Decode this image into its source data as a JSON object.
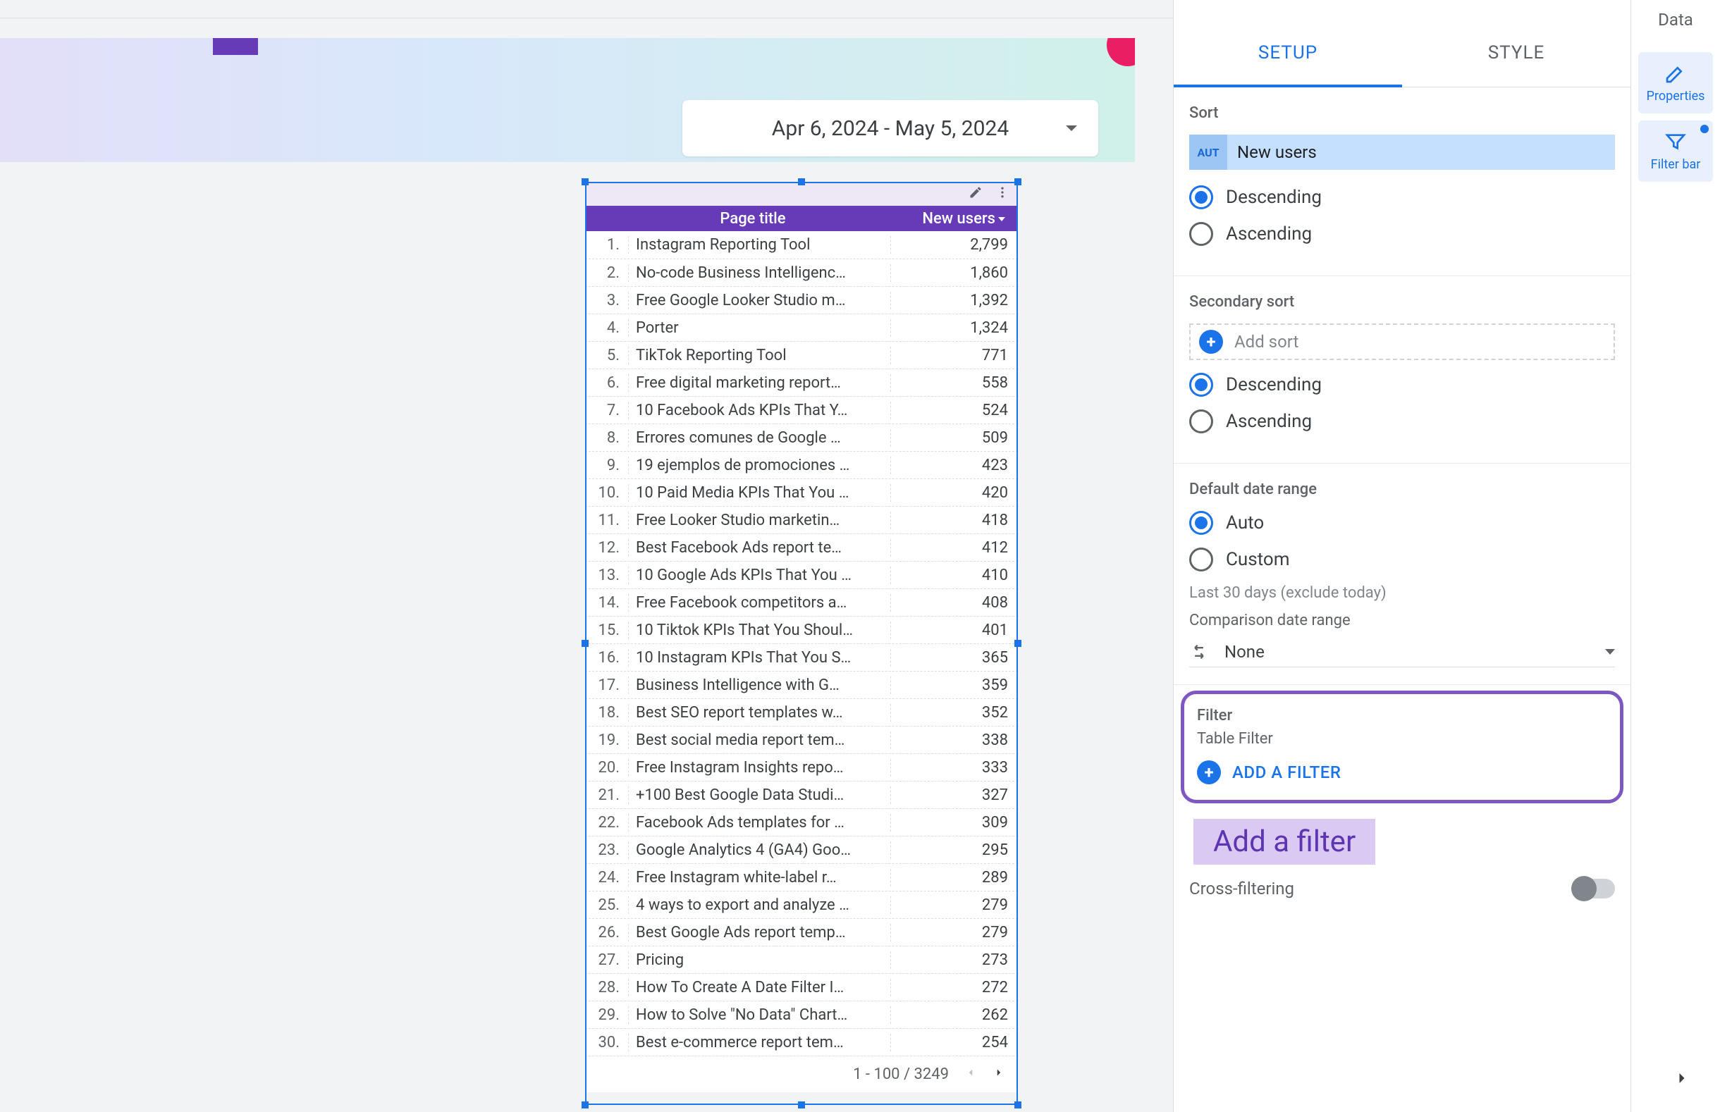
{
  "banner": {
    "date_range": "Apr 6, 2024 - May 5, 2024"
  },
  "chart": {
    "header": {
      "idx": "",
      "title": "Page title",
      "value": "New users"
    },
    "rows": [
      {
        "idx": "1.",
        "title": "Instagram Reporting Tool",
        "value": "2,799"
      },
      {
        "idx": "2.",
        "title": "No-code Business Intelligenc…",
        "value": "1,860"
      },
      {
        "idx": "3.",
        "title": "Free Google Looker Studio m…",
        "value": "1,392"
      },
      {
        "idx": "4.",
        "title": "Porter",
        "value": "1,324"
      },
      {
        "idx": "5.",
        "title": "TikTok Reporting Tool",
        "value": "771"
      },
      {
        "idx": "6.",
        "title": "Free digital marketing report…",
        "value": "558"
      },
      {
        "idx": "7.",
        "title": "10 Facebook Ads KPIs That Y…",
        "value": "524"
      },
      {
        "idx": "8.",
        "title": "Errores comunes de Google …",
        "value": "509"
      },
      {
        "idx": "9.",
        "title": "19 ejemplos de promociones …",
        "value": "423"
      },
      {
        "idx": "10.",
        "title": "10 Paid Media KPIs That You …",
        "value": "420"
      },
      {
        "idx": "11.",
        "title": "Free Looker Studio marketin…",
        "value": "418"
      },
      {
        "idx": "12.",
        "title": "Best Facebook Ads report te…",
        "value": "412"
      },
      {
        "idx": "13.",
        "title": "10 Google Ads KPIs That You …",
        "value": "410"
      },
      {
        "idx": "14.",
        "title": "Free Facebook competitors a…",
        "value": "408"
      },
      {
        "idx": "15.",
        "title": "10 Tiktok KPIs That You Shoul…",
        "value": "401"
      },
      {
        "idx": "16.",
        "title": "10 Instagram KPIs That You S…",
        "value": "365"
      },
      {
        "idx": "17.",
        "title": "Business Intelligence with G…",
        "value": "359"
      },
      {
        "idx": "18.",
        "title": "Best SEO report templates w…",
        "value": "352"
      },
      {
        "idx": "19.",
        "title": "Best social media report tem…",
        "value": "338"
      },
      {
        "idx": "20.",
        "title": "Free Instagram Insights repo…",
        "value": "333"
      },
      {
        "idx": "21.",
        "title": "+100 Best Google Data Studi…",
        "value": "327"
      },
      {
        "idx": "22.",
        "title": "Facebook Ads templates for …",
        "value": "309"
      },
      {
        "idx": "23.",
        "title": "Google Analytics 4 (GA4) Goo…",
        "value": "295"
      },
      {
        "idx": "24.",
        "title": "Free Instagram white-label r…",
        "value": "289"
      },
      {
        "idx": "25.",
        "title": "4 ways to export and analyze …",
        "value": "279"
      },
      {
        "idx": "26.",
        "title": "Best Google Ads report temp…",
        "value": "279"
      },
      {
        "idx": "27.",
        "title": "Pricing",
        "value": "273"
      },
      {
        "idx": "28.",
        "title": "How To Create A Date Filter I…",
        "value": "272"
      },
      {
        "idx": "29.",
        "title": "How to Solve \"No Data\" Chart…",
        "value": "262"
      },
      {
        "idx": "30.",
        "title": "Best e-commerce report tem…",
        "value": "254"
      }
    ],
    "footer": {
      "range": "1 - 100 / 3249"
    }
  },
  "panel": {
    "tabs": {
      "setup": "SETUP",
      "style": "STYLE"
    },
    "sort": {
      "title": "Sort",
      "chip_badge": "AUT",
      "chip_text": "New users",
      "desc": "Descending",
      "asc": "Ascending"
    },
    "secondary": {
      "title": "Secondary sort",
      "add": "Add sort",
      "desc": "Descending",
      "asc": "Ascending"
    },
    "date": {
      "title": "Default date range",
      "auto": "Auto",
      "custom": "Custom",
      "hint": "Last 30 days (exclude today)",
      "compare_title": "Comparison date range",
      "compare_value": "None"
    },
    "filter": {
      "title": "Filter",
      "sub": "Table Filter",
      "add": "ADD A FILTER"
    },
    "callout": "Add a filter",
    "cross": "Cross-filtering"
  },
  "rail": {
    "title": "Data",
    "properties": "Properties",
    "filterbar": "Filter bar"
  },
  "chart_data": {
    "type": "table",
    "title": "Page title vs New users",
    "columns": [
      "Page title",
      "New users"
    ],
    "rows": [
      [
        "Instagram Reporting Tool",
        2799
      ],
      [
        "No-code Business Intelligence",
        1860
      ],
      [
        "Free Google Looker Studio m…",
        1392
      ],
      [
        "Porter",
        1324
      ],
      [
        "TikTok Reporting Tool",
        771
      ],
      [
        "Free digital marketing report…",
        558
      ],
      [
        "10 Facebook Ads KPIs That Y…",
        524
      ],
      [
        "Errores comunes de Google …",
        509
      ],
      [
        "19 ejemplos de promociones …",
        423
      ],
      [
        "10 Paid Media KPIs That You …",
        420
      ],
      [
        "Free Looker Studio marketin…",
        418
      ],
      [
        "Best Facebook Ads report te…",
        412
      ],
      [
        "10 Google Ads KPIs That You …",
        410
      ],
      [
        "Free Facebook competitors a…",
        408
      ],
      [
        "10 Tiktok KPIs That You Shoul…",
        401
      ],
      [
        "10 Instagram KPIs That You S…",
        365
      ],
      [
        "Business Intelligence with G…",
        359
      ],
      [
        "Best SEO report templates w…",
        352
      ],
      [
        "Best social media report tem…",
        338
      ],
      [
        "Free Instagram Insights repo…",
        333
      ],
      [
        "+100 Best Google Data Studi…",
        327
      ],
      [
        "Facebook Ads templates for …",
        309
      ],
      [
        "Google Analytics 4 (GA4) Goo…",
        295
      ],
      [
        "Free Instagram white-label r…",
        289
      ],
      [
        "4 ways to export and analyze …",
        279
      ],
      [
        "Best Google Ads report temp…",
        279
      ],
      [
        "Pricing",
        273
      ],
      [
        "How To Create A Date Filter I…",
        272
      ],
      [
        "How to Solve \"No Data\" Chart…",
        262
      ],
      [
        "Best e-commerce report tem…",
        254
      ]
    ],
    "total_rows": 3249,
    "page": "1 - 100"
  }
}
